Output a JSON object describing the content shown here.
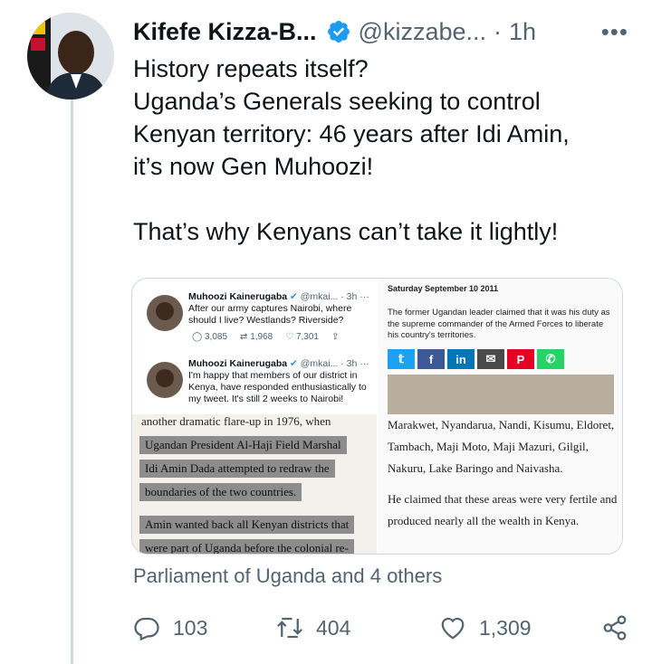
{
  "tweet": {
    "display_name": "Kifefe Kizza-B...",
    "handle": "@kizzabe...",
    "separator": "·",
    "time": "1h",
    "more": "•••",
    "text_lines": [
      "History repeats itself?",
      "Uganda’s Generals seeking to control",
      "Kenyan territory: 46 years after Idi Amin,",
      "it’s now Gen Muhoozi!"
    ],
    "text_after_gap": "That’s why Kenyans can’t take it lightly!",
    "others": "Parliament of Uganda and 4 others",
    "actions": {
      "replies": "103",
      "retweets": "404",
      "likes": "1,309"
    }
  },
  "media": {
    "embedded_tweets": [
      {
        "name": "Muhoozi Kainerugaba",
        "handle": "@mkai... · 3h",
        "more": "···",
        "text": "After our army captures Nairobi, where should I live? Westlands? Riverside?",
        "stats": [
          "3,085",
          "1,968",
          "7,301"
        ]
      },
      {
        "name": "Muhoozi Kainerugaba",
        "handle": "@mkai... · 3h",
        "more": "···",
        "text": "I'm happy that members of our district in Kenya, have responded enthusiastically to my tweet. It's still 2 weeks to Nairobi!"
      }
    ],
    "clip_left": [
      "another dramatic flare-up in 1976, when",
      "Ugandan President Al-Haji Field Marshal",
      "Idi Amin Dada attempted to redraw the",
      "boundaries of the two countries.",
      "Amin wanted back all Kenyan districts that",
      "were part of Uganda before the colonial re-"
    ],
    "news": {
      "date": "Saturday September 10 2011",
      "lead": "The former Ugandan leader claimed that it was his duty as the supreme commander of the Armed Forces to liberate his country's territories.",
      "share_buttons": [
        "twitter-icon",
        "facebook-icon",
        "linkedin-icon",
        "email-icon",
        "pinterest-icon",
        "whatsapp-icon"
      ],
      "paragraph1": "Marakwet, Nyandarua, Nandi, Kisumu, Eldoret, Tambach, Maji Moto, Maji Mazuri, Gilgil, Nakuru, Lake Baringo and Naivasha.",
      "paragraph2": "He claimed that these areas were very fertile and produced nearly all the wealth in Kenya."
    }
  },
  "colors": {
    "text": "#0f1419",
    "muted": "#536471",
    "verified": "#1d9bf0",
    "border": "#cfd9de"
  }
}
